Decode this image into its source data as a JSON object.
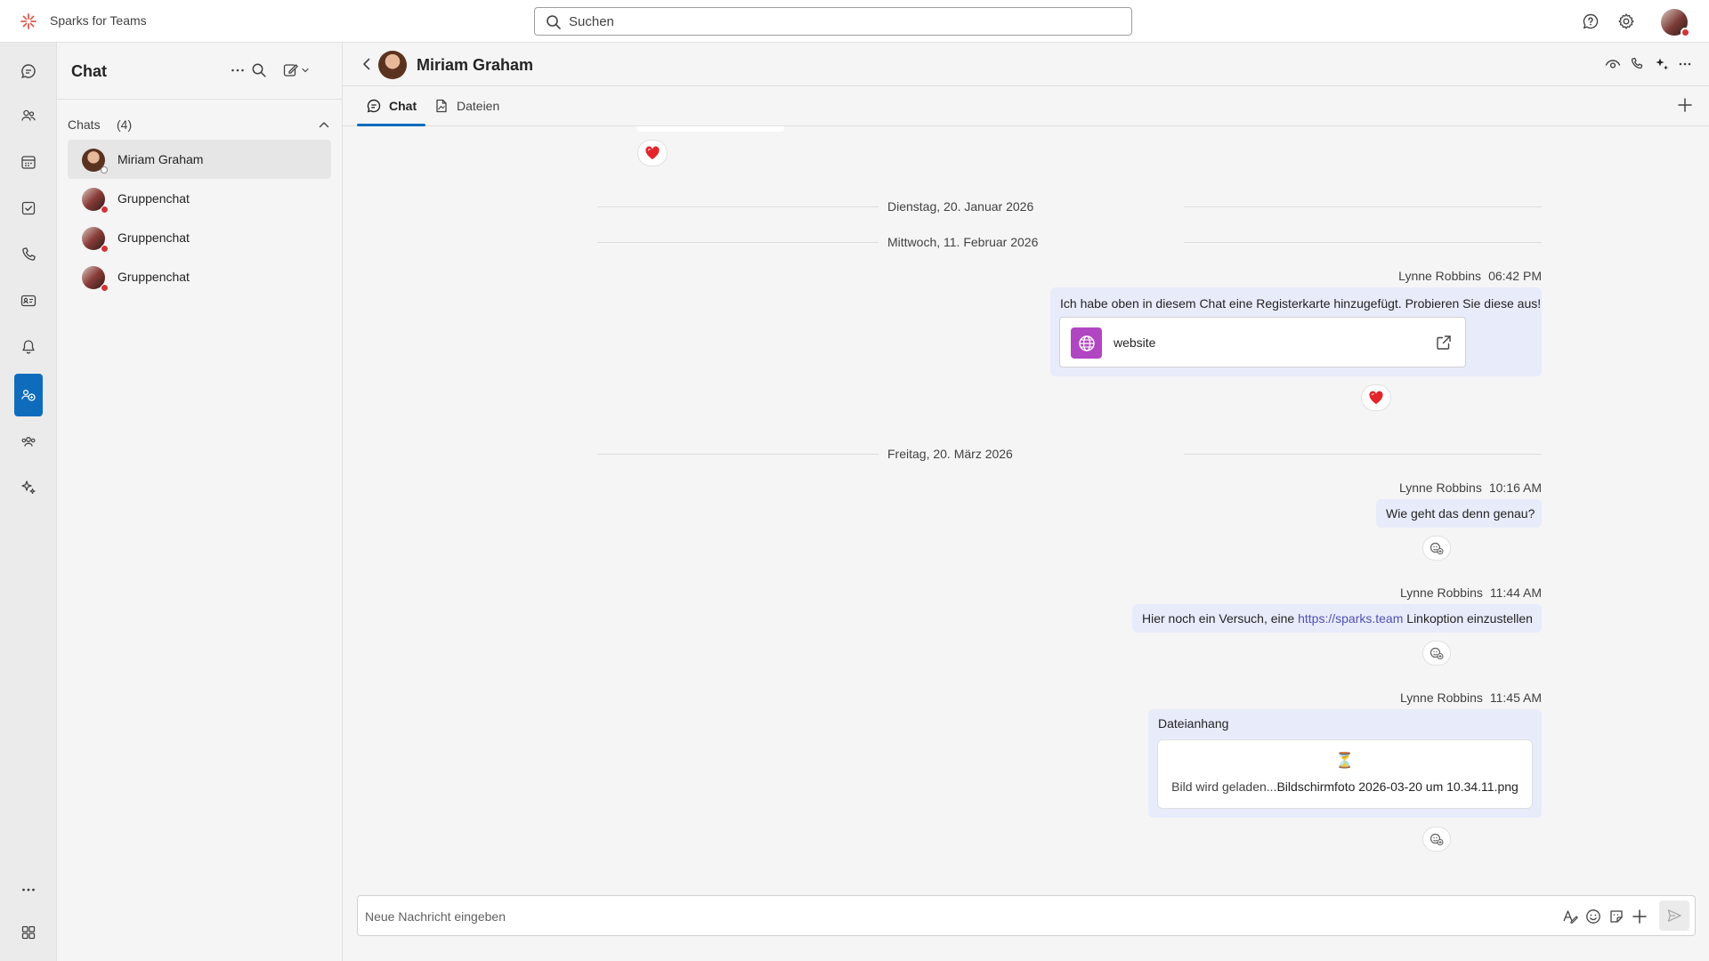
{
  "app": {
    "title": "Sparks for Teams"
  },
  "search": {
    "placeholder": "Suchen"
  },
  "chatlist": {
    "title": "Chat",
    "section_label": "Chats",
    "section_count": "(4)",
    "items": [
      {
        "name": "Miriam Graham"
      },
      {
        "name": "Gruppenchat"
      },
      {
        "name": "Gruppenchat"
      },
      {
        "name": "Gruppenchat"
      }
    ]
  },
  "conversation": {
    "title": "Miriam Graham",
    "tabs": [
      {
        "label": "Chat"
      },
      {
        "label": "Dateien"
      }
    ]
  },
  "messages": {
    "dates": [
      "Dienstag, 20. Januar 2026",
      "Mittwoch, 11. Februar 2026",
      "Freitag, 20. März 2026"
    ],
    "m1": {
      "sender": "Lynne Robbins",
      "time": "06:42 PM",
      "text": "Ich habe oben in diesem Chat eine Registerkarte hinzugefügt. Probieren Sie diese aus!",
      "card_title": "website"
    },
    "m2": {
      "sender": "Lynne Robbins",
      "time": "10:16 AM",
      "text": "Wie geht das denn genau?"
    },
    "m3": {
      "sender": "Lynne Robbins",
      "time": "11:44 AM",
      "text_before": "Hier noch ein Versuch, eine ",
      "link": "https://sparks.team",
      "text_after": " Linkoption einzustellen"
    },
    "m4": {
      "sender": "Lynne Robbins",
      "time": "11:45 AM",
      "title": "Dateianhang",
      "loading_icon": "⏳",
      "loading": "Bild wird geladen...",
      "filename": "Bildschirmfoto 2026-03-20 um 10.34.11.png"
    }
  },
  "compose": {
    "placeholder": "Neue Nachricht eingeben"
  },
  "colors": {
    "accent": "#0f6cbd",
    "bubble": "#e8ebfa",
    "link": "#4f52b2",
    "busy": "#d13438",
    "card_icon": "#b146c2"
  }
}
